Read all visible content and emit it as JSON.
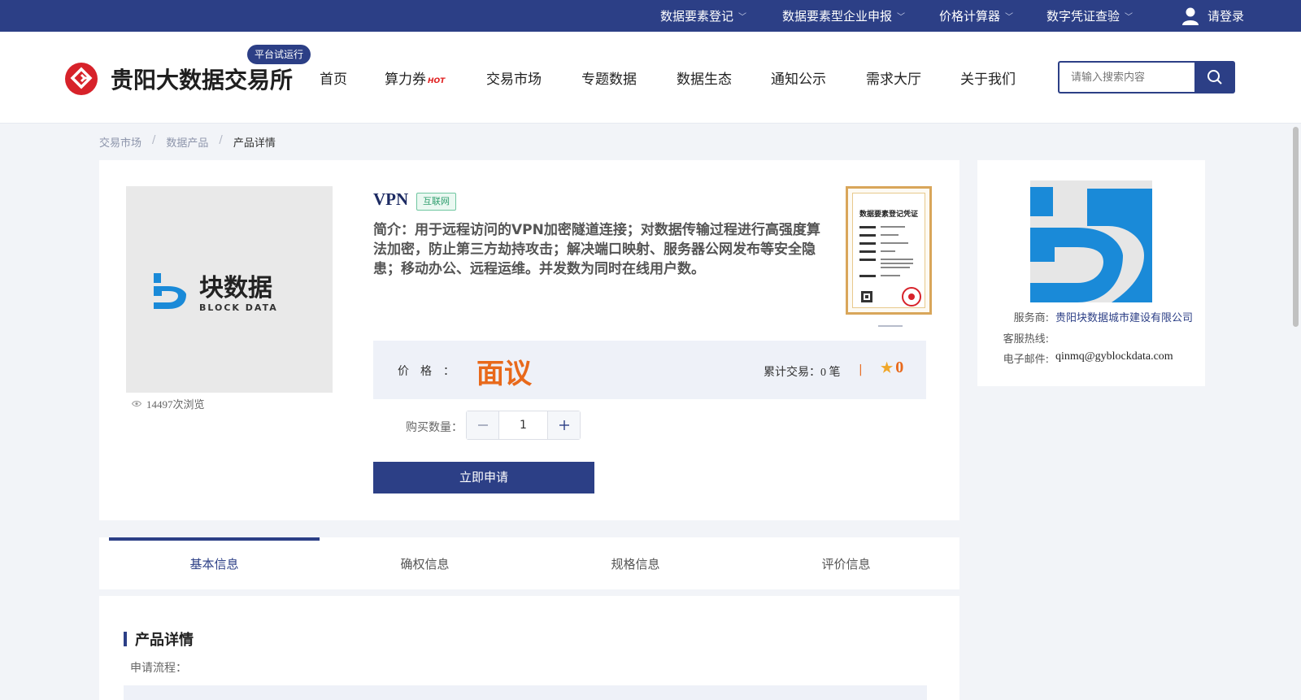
{
  "topbar": {
    "items": [
      {
        "label": "数据要素登记"
      },
      {
        "label": "数据要素型企业申报"
      },
      {
        "label": "价格计算器"
      },
      {
        "label": "数字凭证查验"
      }
    ],
    "login_label": "请登录"
  },
  "header": {
    "brand": "贵阳大数据交易所",
    "trial_badge": "平台试运行",
    "nav": [
      {
        "label": "首页"
      },
      {
        "label": "算力券",
        "tag": "HOT"
      },
      {
        "label": "交易市场"
      },
      {
        "label": "专题数据"
      },
      {
        "label": "数据生态"
      },
      {
        "label": "通知公示"
      },
      {
        "label": "需求大厅"
      },
      {
        "label": "关于我们"
      }
    ],
    "search_placeholder": "请输入搜索内容"
  },
  "breadcrumb": {
    "items": [
      "交易市场",
      "数据产品"
    ],
    "current": "产品详情"
  },
  "product": {
    "image_text": "块数据",
    "image_subtext": "BLOCK DATA",
    "views": "14497次浏览",
    "title": "VPN",
    "category": "互联网",
    "description": "简介：用于远程访问的VPN加密隧道连接；对数据传输过程进行高强度算法加密，防止第三方劫持攻击；解决端口映射、服务器公网发布等安全隐患；移动办公、远程运维。并发数为同时在线用户数。",
    "certificate_title": "数据要素登记凭证",
    "price_label": "价格：",
    "price_value": "面议",
    "trade_count": "累计交易：0 笔",
    "rating": "0",
    "qty_label": "购买数量：",
    "quantity": "1",
    "apply_label": "立即申请"
  },
  "provider": {
    "service_label": "服务商:",
    "service_value": "贵阳块数据城市建设有限公司",
    "hotline_label": "客服热线:",
    "hotline_value": "",
    "email_label": "电子邮件:",
    "email_value": "qinmq@gyblockdata.com"
  },
  "tabs": [
    {
      "label": "基本信息",
      "active": true
    },
    {
      "label": "确权信息"
    },
    {
      "label": "规格信息"
    },
    {
      "label": "评价信息"
    }
  ],
  "details": {
    "title": "产品详情",
    "flow_label": "申请流程："
  },
  "colors": {
    "brand_blue": "#2c3f86",
    "price_orange": "#e8691b",
    "logo_red": "#d7222a",
    "logo_blue": "#1a8ad8"
  }
}
